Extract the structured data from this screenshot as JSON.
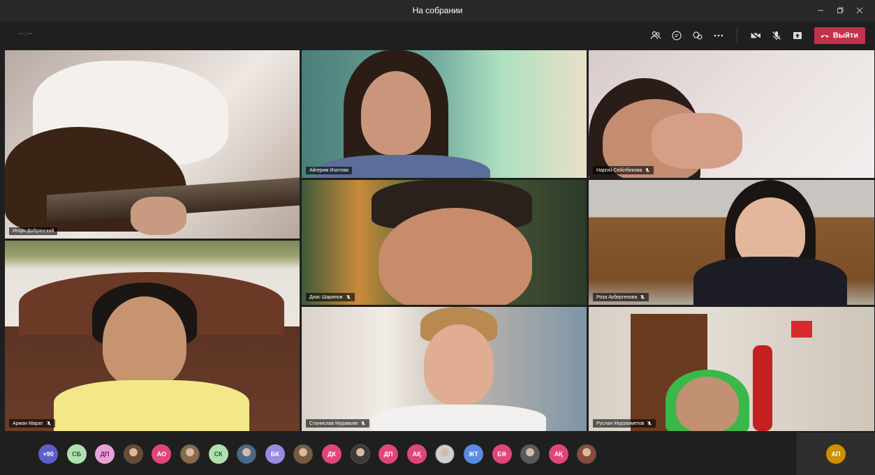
{
  "window": {
    "title": "На собрании"
  },
  "toolbar": {
    "timer": "--:--",
    "leave_label": "Выйти"
  },
  "participants_tiles": [
    {
      "name": "Игорь Добрянский",
      "muted": false
    },
    {
      "name": "Айгерим Изотова",
      "muted": false
    },
    {
      "name": "Наргиз Сейілбекова",
      "muted": true
    },
    {
      "name": "Диас Шарипов",
      "muted": true
    },
    {
      "name": "Роза Акбергенова",
      "muted": true
    },
    {
      "name": "Арман Марат",
      "muted": true
    },
    {
      "name": "Станислав Муравьев",
      "muted": true
    },
    {
      "name": "Руслан Мурзахметов",
      "muted": true
    }
  ],
  "roster": [
    {
      "label": "+90",
      "color": "#5b5fc7",
      "photo": false
    },
    {
      "label": "СБ",
      "color": "#b2dfb0",
      "photo": false,
      "text": "#1f5e1f"
    },
    {
      "label": "ДП",
      "color": "#e8a0d8",
      "photo": false,
      "text": "#7a1f6a"
    },
    {
      "label": "",
      "color": "#6b4a2f",
      "photo": true
    },
    {
      "label": "АО",
      "color": "#e0467a",
      "photo": false
    },
    {
      "label": "",
      "color": "#8a6a4a",
      "photo": true
    },
    {
      "label": "СК",
      "color": "#b2dfb0",
      "photo": false,
      "text": "#1f5e1f"
    },
    {
      "label": "",
      "color": "#4a6a8a",
      "photo": true
    },
    {
      "label": "БК",
      "color": "#9a8ae0",
      "photo": false
    },
    {
      "label": "",
      "color": "#7a5a3a",
      "photo": true
    },
    {
      "label": "ДК",
      "color": "#e0467a",
      "photo": false
    },
    {
      "label": "",
      "color": "#3a3a3a",
      "photo": true
    },
    {
      "label": "ДП",
      "color": "#e0467a",
      "photo": false
    },
    {
      "label": "АҚ",
      "color": "#e0467a",
      "photo": false
    },
    {
      "label": "",
      "color": "#d0d0d0",
      "photo": true
    },
    {
      "label": "ЖТ",
      "color": "#5b8ae0",
      "photo": false
    },
    {
      "label": "ЕӘ",
      "color": "#e0467a",
      "photo": false
    },
    {
      "label": "",
      "color": "#5a5a5a",
      "photo": true
    },
    {
      "label": "АҚ",
      "color": "#e0467a",
      "photo": false
    },
    {
      "label": "",
      "color": "#8a4a3a",
      "photo": true
    }
  ],
  "self": {
    "label": "АП"
  },
  "colors": {
    "leave": "#c4314b",
    "self_avatar": "#d08f00"
  }
}
